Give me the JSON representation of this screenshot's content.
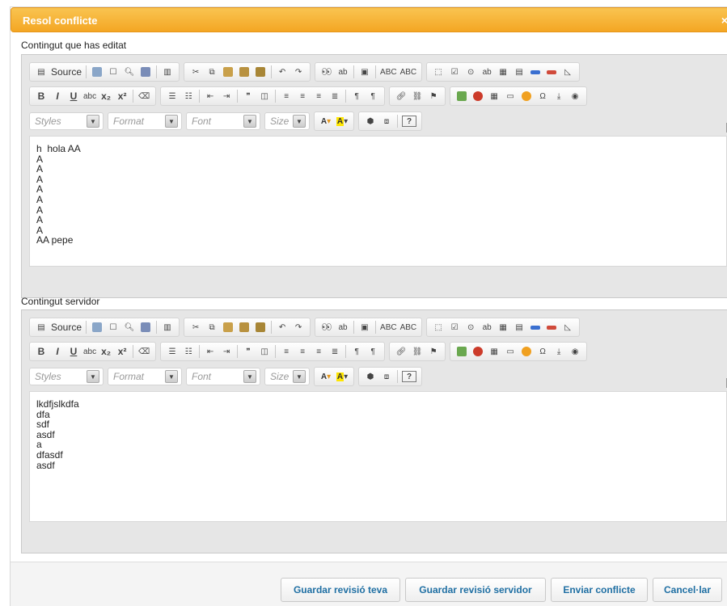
{
  "dialog": {
    "title": "Resol conflicte",
    "close_label": "×"
  },
  "sections": {
    "edited_label": "Contingut que has editat",
    "server_label": "Contingut servidor"
  },
  "toolbar": {
    "source_label": "Source",
    "combos": {
      "styles": "Styles",
      "format": "Format",
      "font": "Font",
      "size": "Size"
    },
    "glyphs": {
      "bold": "B",
      "italic": "I",
      "underline": "U",
      "strike": "abc",
      "subscript": "x₂",
      "superscript": "x²",
      "blockquote": "❞",
      "omega": "Ω",
      "help": "?",
      "abc": "ABC"
    }
  },
  "editor_edited": {
    "lines": [
      "h  hola AA",
      "A",
      "A",
      "A",
      "A",
      "A",
      "A",
      "A",
      "A",
      "AA pepe"
    ]
  },
  "editor_server": {
    "lines": [
      "lkdfjslkdfa",
      "dfa",
      "sdf",
      "asdf",
      "a",
      "dfasdf",
      "asdf"
    ]
  },
  "footer": {
    "save_mine": "Guardar revisió teva",
    "save_server": "Guardar revisió servidor",
    "send_conflict": "Enviar conflicte",
    "cancel": "Cancel·lar"
  },
  "colors": {
    "title_bar": "#f4a623",
    "button_text": "#1f6fa3"
  }
}
